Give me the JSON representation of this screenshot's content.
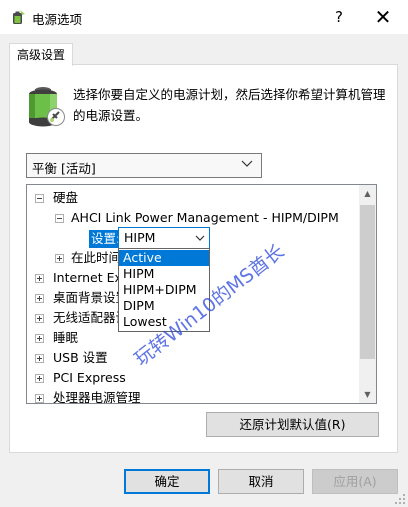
{
  "window": {
    "title": "电源选项",
    "help_label": "?",
    "close_label": "✕"
  },
  "tab": {
    "label": "高级设置"
  },
  "description": "选择你要自定义的电源计划，然后选择你希望计算机管理的电源设置。",
  "plan_select": {
    "value": "平衡 [活动]"
  },
  "tree": {
    "items": [
      {
        "label": "硬盘",
        "expander": "minus"
      },
      {
        "label": "AHCI Link Power Management - HIPM/DIPM",
        "expander": "minus"
      },
      {
        "label": "设置:",
        "expander": "none"
      },
      {
        "label": "在此时间",
        "expander": "plus"
      },
      {
        "label": "Internet Exp",
        "expander": "plus"
      },
      {
        "label": "桌面背景设置",
        "expander": "plus"
      },
      {
        "label": "无线适配器设",
        "expander": "plus"
      },
      {
        "label": "睡眠",
        "expander": "plus"
      },
      {
        "label": "USB 设置",
        "expander": "plus"
      },
      {
        "label": "PCI Express",
        "expander": "plus"
      },
      {
        "label": "处理器电源管理",
        "expander": "plus"
      }
    ]
  },
  "setting_combo": {
    "value": "HIPM",
    "options": [
      "Active",
      "HIPM",
      "HIPM+DIPM",
      "DIPM",
      "Lowest"
    ],
    "highlighted": "Active"
  },
  "watermark": "玩转Win10的MS酋长",
  "restore_button": "还原计划默认值(R)",
  "footer": {
    "ok": "确定",
    "cancel": "取消",
    "apply": "应用(A)"
  },
  "colors": {
    "accent": "#0078d7",
    "dialog_bg": "#f0f0f0",
    "watermark": "#2846dc"
  }
}
